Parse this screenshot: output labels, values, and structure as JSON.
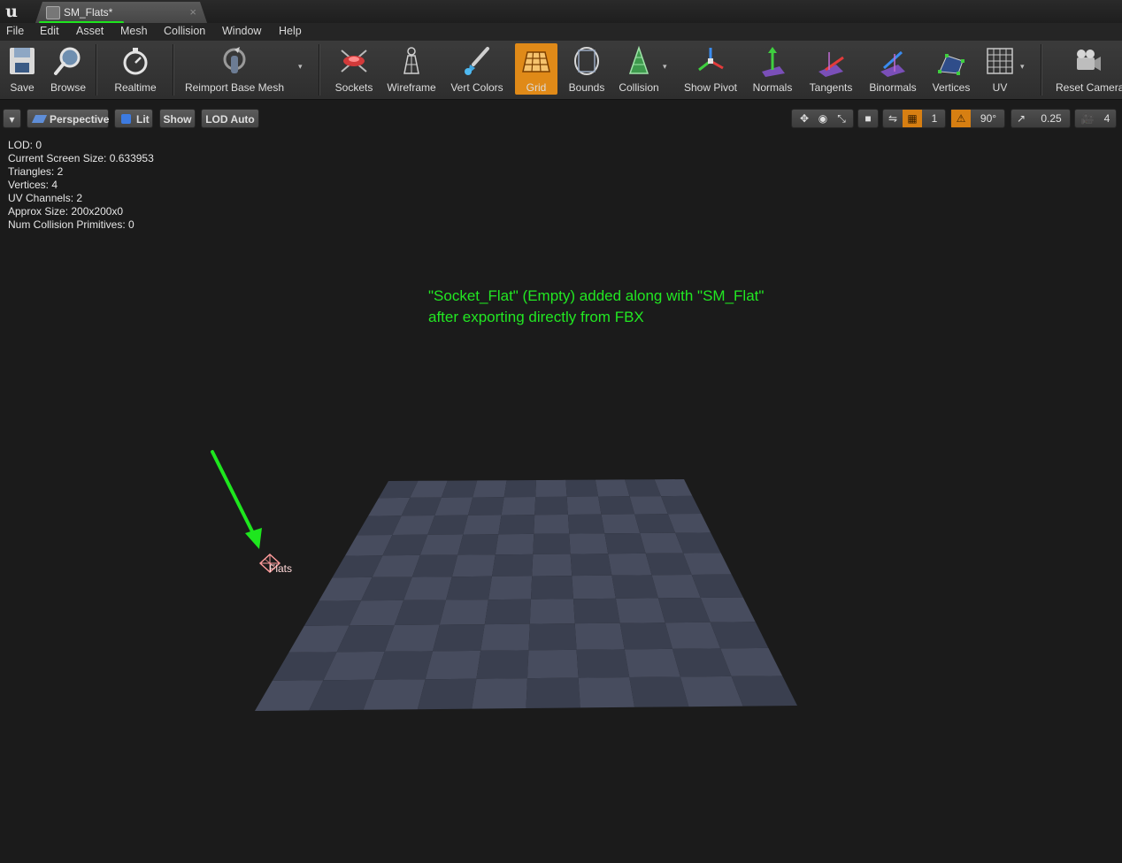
{
  "window": {
    "tab_title": "SM_Flats*",
    "tab_close": "×",
    "logo": "u"
  },
  "menu": [
    "File",
    "Edit",
    "Asset",
    "Mesh",
    "Collision",
    "Window",
    "Help"
  ],
  "toolbar": {
    "save": "Save",
    "browse": "Browse",
    "realtime": "Realtime",
    "reimport": "Reimport Base Mesh",
    "sockets": "Sockets",
    "wireframe": "Wireframe",
    "vert_colors": "Vert Colors",
    "grid": "Grid",
    "bounds": "Bounds",
    "collision": "Collision",
    "show_pivot": "Show Pivot",
    "normals": "Normals",
    "tangents": "Tangents",
    "binormals": "Binormals",
    "vertices": "Vertices",
    "uv": "UV",
    "reset_camera": "Reset Camera",
    "grid_active_color": "#e08a18"
  },
  "viewport": {
    "perspective": "Perspective",
    "lit": "Lit",
    "show": "Show",
    "lod": "LOD Auto",
    "grid_size": "1",
    "rotation_snap": "90°",
    "scale_snap": "0.25",
    "camera_speed": "4",
    "dropdown_arrow": "▾"
  },
  "stats": {
    "lod": "LOD:  0",
    "screen_size": "Current Screen Size:  0.633953",
    "triangles": "Triangles:  2",
    "vertices": "Vertices:  4",
    "uv_channels": "UV Channels:  2",
    "approx_size": "Approx Size: 200x200x0",
    "collision": "Num Collision Primitives:  0"
  },
  "annotation": {
    "line1": "\"Socket_Flat\" (Empty) added along with \"SM_Flat\"",
    "line2": "after exporting directly from FBX",
    "color": "#22e722"
  },
  "socket": {
    "label": "Flats"
  }
}
